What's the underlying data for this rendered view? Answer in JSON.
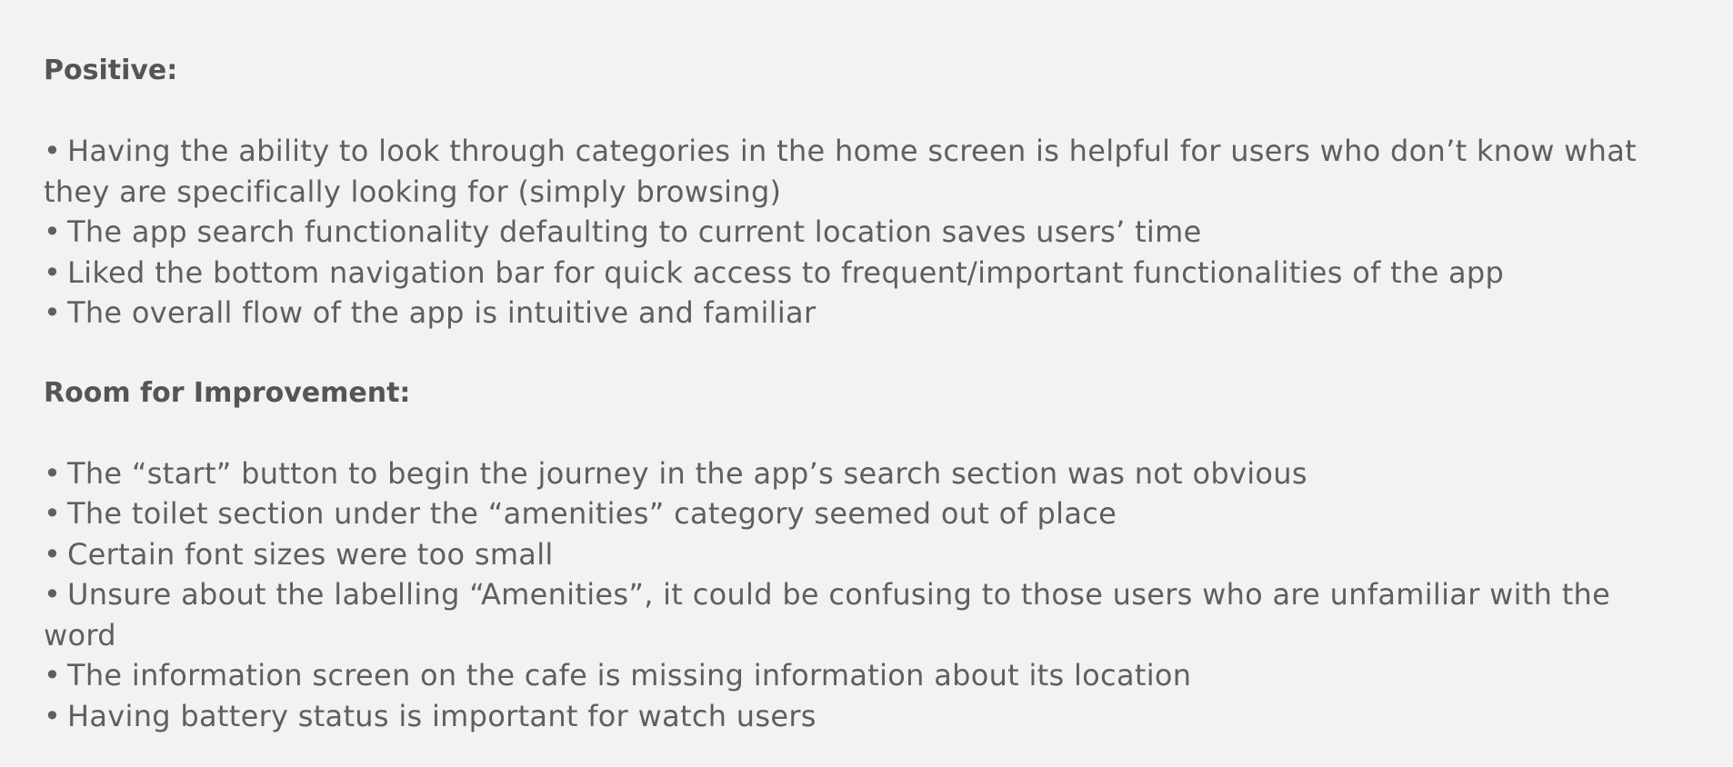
{
  "positive": {
    "heading": "Positive:",
    "items": [
      "Having the ability to look through categories in the home screen is helpful for users who don’t know what they are specifically looking for (simply browsing)",
      "The app search functionality defaulting to current location saves users’ time",
      "Liked the bottom navigation bar for quick access to frequent/important functionalities of the app",
      "The overall flow of the app is intuitive and familiar"
    ]
  },
  "improvement": {
    "heading": "Room for Improvement:",
    "items": [
      "The “start” button to begin the journey in the app’s search section was not obvious",
      "The toilet section under the “amenities” category seemed out of place",
      "Certain font sizes were too small",
      "Unsure about the labelling “Amenities”, it could be confusing to those users who are unfamiliar with the word",
      "The information screen on the cafe is missing information about its location",
      "Having battery status is important for watch users"
    ]
  },
  "bullet_symbol": "•"
}
